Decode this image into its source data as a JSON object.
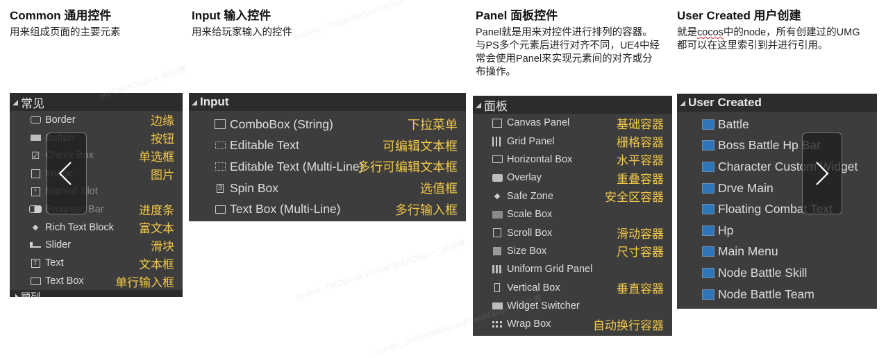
{
  "columns": [
    {
      "title": "Common 通用控件",
      "description": "用来组成页面的主要元素",
      "panel": {
        "header": "常见",
        "items": [
          {
            "label": "Border",
            "icon": "border-icon",
            "note": "边缘"
          },
          {
            "label": "Button",
            "icon": "button-icon",
            "note": "按钮"
          },
          {
            "label": "Check Box",
            "icon": "checkbox-icon",
            "note": "单选框"
          },
          {
            "label": "Image",
            "icon": "image-icon",
            "note": "图片"
          },
          {
            "label": "Named Slot",
            "icon": "named-slot-icon",
            "note": ""
          },
          {
            "label": "Progress Bar",
            "icon": "progress-bar-icon",
            "note": "进度条"
          },
          {
            "label": "Rich Text Block",
            "icon": "diamond-icon",
            "note": "富文本"
          },
          {
            "label": "Slider",
            "icon": "slider-icon",
            "note": "滑块"
          },
          {
            "label": "Text",
            "icon": "text-icon",
            "note": "文本框"
          },
          {
            "label": "Text Box",
            "icon": "textbox-icon",
            "note": "单行输入框"
          }
        ],
        "next_header_partial": "顾列"
      }
    },
    {
      "title": "Input 输入控件",
      "description": "用来给玩家输入的控件",
      "panel": {
        "header": "Input",
        "items": [
          {
            "label": "ComboBox (String)",
            "icon": "combobox-icon",
            "note": "下拉菜单"
          },
          {
            "label": "Editable Text",
            "icon": "editable-text-icon",
            "note": "可编辑文本框"
          },
          {
            "label": "Editable Text (Multi-Line)",
            "icon": "editable-multiline-icon",
            "note": "多行可编辑文本框"
          },
          {
            "label": "Spin Box",
            "icon": "spinbox-icon",
            "note": "选值框"
          },
          {
            "label": "Text Box (Multi-Line)",
            "icon": "textbox-multiline-icon",
            "note": "多行输入框"
          }
        ]
      }
    },
    {
      "title": "Panel 面板控件",
      "description": "Panel就是用来对控件进行排列的容器。与PS多个元素后进行对齐不同，UE4中经常会使用Panel来实现元素间的对齐或分布操作。",
      "panel": {
        "header": "面板",
        "items": [
          {
            "label": "Canvas Panel",
            "icon": "canvas-panel-icon",
            "note": "基础容器"
          },
          {
            "label": "Grid Panel",
            "icon": "grid-panel-icon",
            "note": "栅格容器"
          },
          {
            "label": "Horizontal Box",
            "icon": "horizontal-box-icon",
            "note": "水平容器"
          },
          {
            "label": "Overlay",
            "icon": "overlay-icon",
            "note": "重叠容器"
          },
          {
            "label": "Safe Zone",
            "icon": "diamond-icon",
            "note": "安全区容器"
          },
          {
            "label": "Scale Box",
            "icon": "scale-box-icon",
            "note": ""
          },
          {
            "label": "Scroll Box",
            "icon": "scroll-box-icon",
            "note": "滑动容器"
          },
          {
            "label": "Size Box",
            "icon": "size-box-icon",
            "note": "尺寸容器"
          },
          {
            "label": "Uniform Grid Panel",
            "icon": "uniform-grid-icon",
            "note": ""
          },
          {
            "label": "Vertical Box",
            "icon": "vertical-box-icon",
            "note": "垂直容器"
          },
          {
            "label": "Widget Switcher",
            "icon": "widget-switcher-icon",
            "note": ""
          },
          {
            "label": "Wrap Box",
            "icon": "wrap-box-icon",
            "note": "自动换行容器"
          }
        ]
      }
    },
    {
      "title": "User Created 用户创建",
      "description_parts": [
        "就是",
        "cocos",
        "中的node，所有创建过的UMG都可以在这里索引到并进行引用。"
      ],
      "panel": {
        "header": "User Created",
        "items": [
          {
            "label": "Battle"
          },
          {
            "label": "Boss Battle Hp Bar"
          },
          {
            "label": "Character Custom Widget"
          },
          {
            "label": "Drve Main"
          },
          {
            "label": "Floating Combat Text"
          },
          {
            "label": "Hp"
          },
          {
            "label": "Main Menu"
          },
          {
            "label": "Node Battle Skill"
          },
          {
            "label": "Node Battle Team"
          }
        ]
      }
    }
  ],
  "carousel": {
    "prev_icon": "chevron-left-icon",
    "next_icon": "chevron-right-icon"
  },
  "colors": {
    "panel_bg": "#3d3d3d",
    "header_bg": "#2c2c2c",
    "note": "#f3c948",
    "widget_blue": "#2f76b8"
  }
}
